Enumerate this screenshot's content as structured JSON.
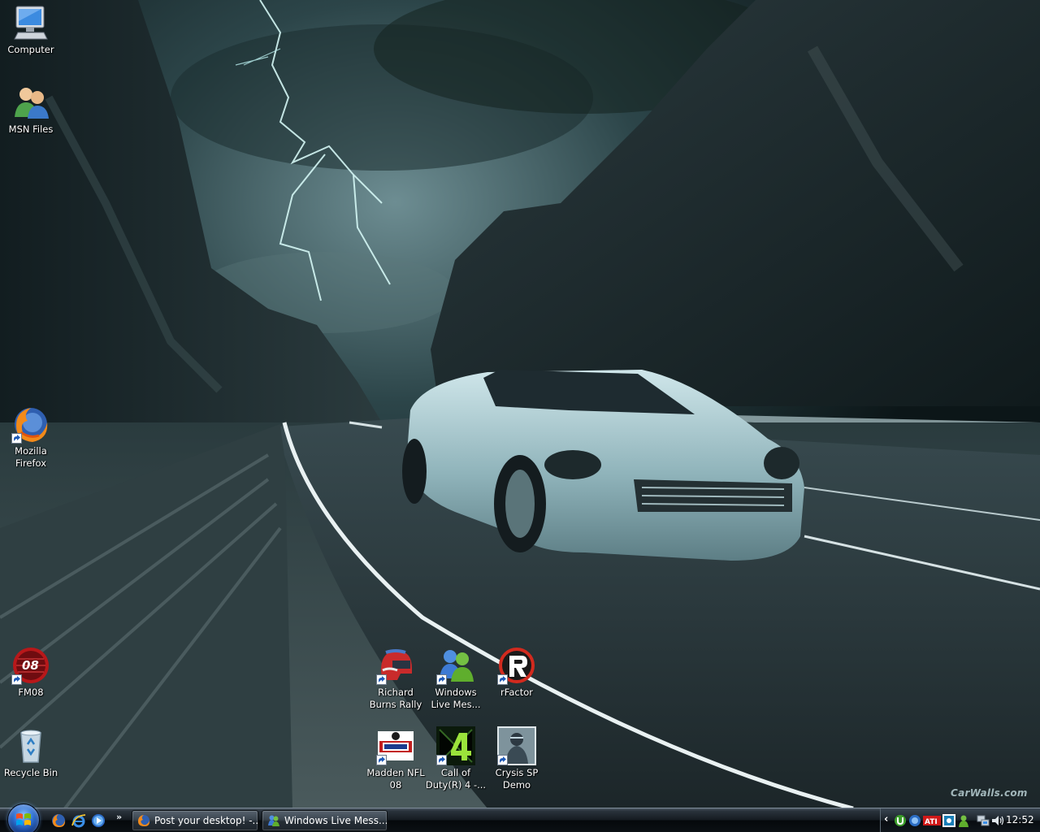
{
  "desktop": {
    "watermark": "CarWalls.com",
    "icons": [
      {
        "id": "computer",
        "label": "Computer",
        "icon": "computer-icon"
      },
      {
        "id": "msn-files",
        "label": "MSN Files",
        "icon": "users-folder-icon"
      },
      {
        "id": "firefox",
        "label": "Mozilla\nFirefox",
        "icon": "firefox-icon",
        "shortcut": true
      },
      {
        "id": "fm08",
        "label": "FM08",
        "icon": "football-manager-icon",
        "shortcut": true
      },
      {
        "id": "recycle",
        "label": "Recycle Bin",
        "icon": "recycle-bin-icon"
      },
      {
        "id": "rbr",
        "label": "Richard\nBurns Rally",
        "icon": "rally-helmet-icon",
        "shortcut": true
      },
      {
        "id": "wlm",
        "label": "Windows\nLive Mes...",
        "icon": "messenger-icon",
        "shortcut": true
      },
      {
        "id": "rfactor",
        "label": "rFactor",
        "icon": "rfactor-icon",
        "shortcut": true
      },
      {
        "id": "madden",
        "label": "Madden NFL\n08",
        "icon": "madden-icon",
        "shortcut": true
      },
      {
        "id": "cod4",
        "label": "Call of\nDuty(R) 4 -...",
        "icon": "cod4-icon",
        "shortcut": true
      },
      {
        "id": "crysis",
        "label": "Crysis SP\nDemo",
        "icon": "crysis-icon",
        "shortcut": true
      }
    ]
  },
  "taskbar": {
    "start_icon": "windows-start-orb-icon",
    "quick_launch": [
      {
        "name": "firefox-quicklaunch-icon"
      },
      {
        "name": "internet-explorer-quicklaunch-icon"
      },
      {
        "name": "windows-media-player-quicklaunch-icon"
      }
    ],
    "overflow_label": "»",
    "tasks": [
      {
        "label": "Post your desktop! -...",
        "icon": "firefox-icon"
      },
      {
        "label": "Windows Live Mess...",
        "icon": "messenger-icon"
      }
    ],
    "tray": {
      "chevron": "‹",
      "icons": [
        "utorrent-icon",
        "network-activity-icon",
        "ati-catalyst-icon",
        "steam-icon",
        "messenger-status-icon",
        "network-icon",
        "volume-icon"
      ],
      "clock": "12:52"
    }
  }
}
